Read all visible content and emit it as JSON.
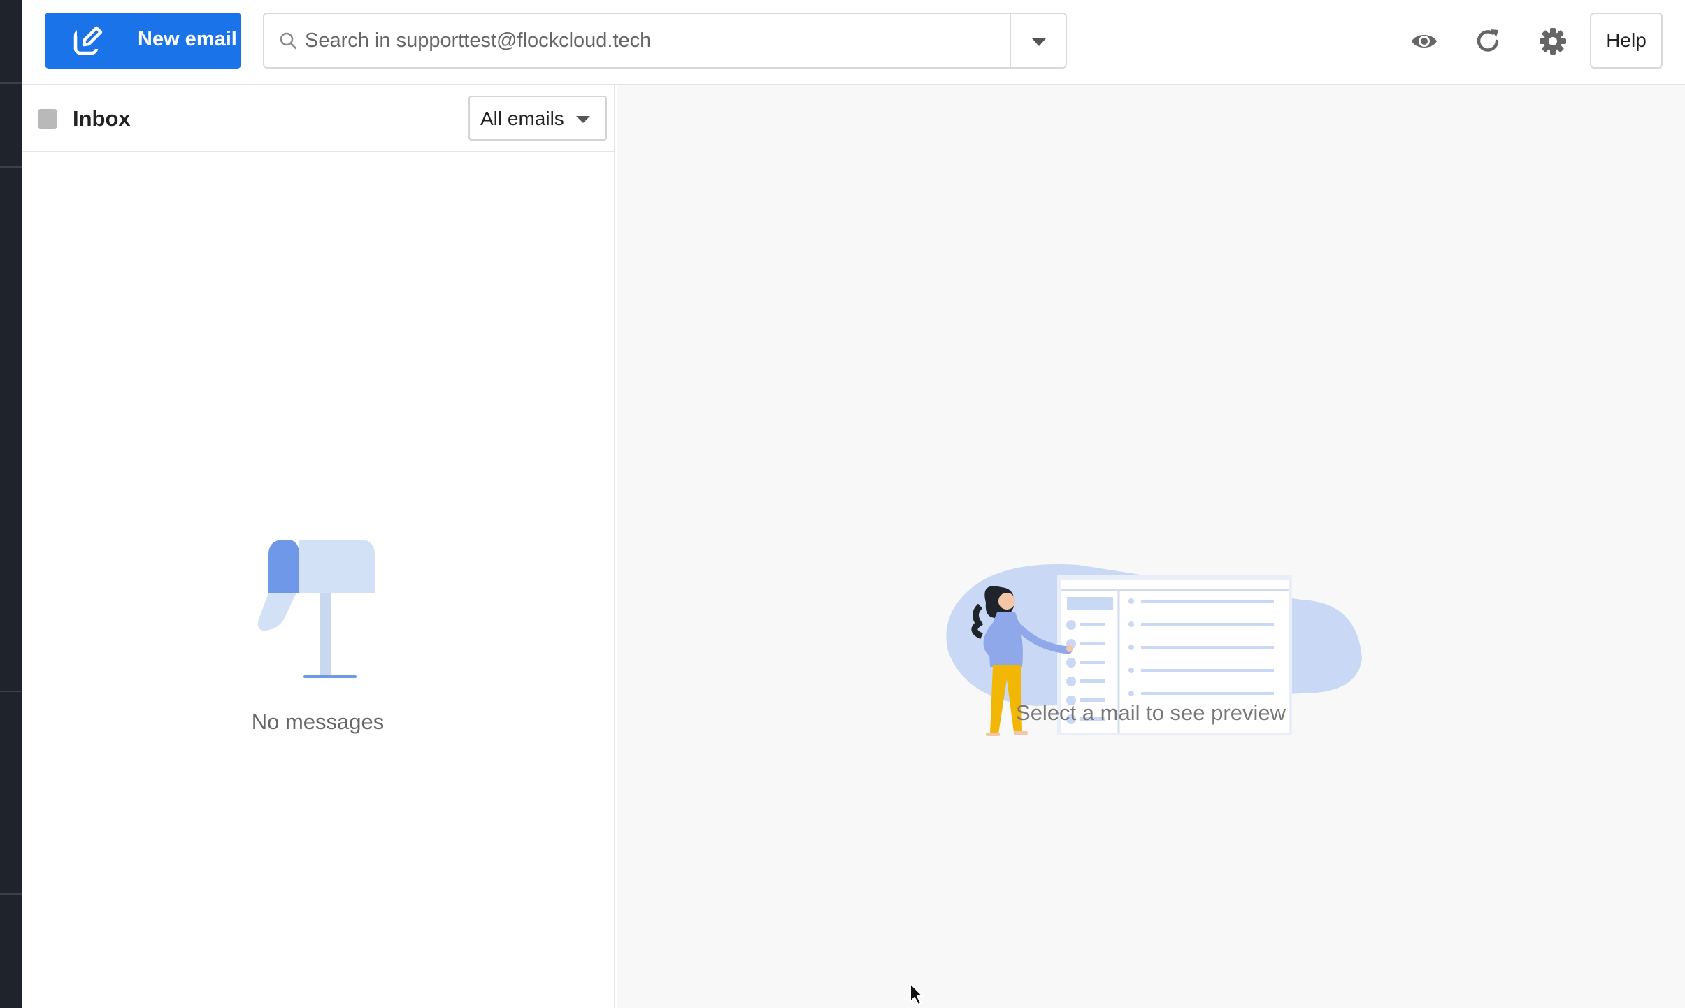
{
  "toolbar": {
    "new_email_label": "New email",
    "search_placeholder": "Search in supporttest@flockcloud.tech",
    "help_label": "Help",
    "icons": [
      "compose-icon",
      "search-icon",
      "chevron-down-icon",
      "eye-icon",
      "refresh-icon",
      "gear-icon"
    ]
  },
  "list": {
    "title": "Inbox",
    "filter_label": "All emails",
    "empty_text": "No messages"
  },
  "preview": {
    "empty_text": "Select a mail to see preview"
  },
  "colors": {
    "accent": "#1a73e8",
    "rail": "#1f232b",
    "illustration_blue": "#c9d9f5",
    "illustration_pants": "#f2b705"
  }
}
